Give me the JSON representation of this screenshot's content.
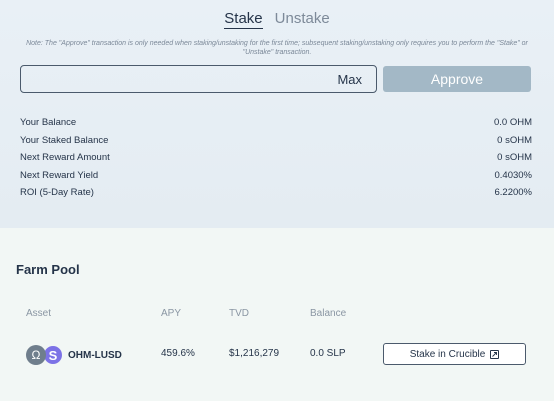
{
  "tabs": [
    {
      "label": "Stake",
      "active": true
    },
    {
      "label": "Unstake",
      "active": false
    }
  ],
  "note": "Note: The \"Approve\" transaction is only needed when staking/unstaking for the first time; subsequent staking/unstaking only requires you to perform the \"Stake\" or \"Unstake\" transaction.",
  "amount_input": {
    "value": "",
    "max_label": "Max"
  },
  "approve_label": "Approve",
  "stats": [
    {
      "label": "Your Balance",
      "value": "0.0 OHM"
    },
    {
      "label": "Your Staked Balance",
      "value": "0 sOHM"
    },
    {
      "label": "Next Reward Amount",
      "value": "0 sOHM"
    },
    {
      "label": "Next Reward Yield",
      "value": "0.4030%"
    },
    {
      "label": "ROI (5-Day Rate)",
      "value": "6.2200%"
    }
  ],
  "farm": {
    "title": "Farm Pool",
    "headers": {
      "asset": "Asset",
      "apy": "APY",
      "tvd": "TVD",
      "balance": "Balance"
    },
    "row": {
      "asset": "OHM-LUSD",
      "ohm_icon_glyph": "Ω",
      "lusd_icon_glyph": "S",
      "apy": "459.6%",
      "tvd": "$1,216,279",
      "balance": "0.0 SLP",
      "action": "Stake in Crucible"
    }
  },
  "colors": {
    "accent": "#a3b8c6",
    "text": "#253449",
    "muted": "#8a96a3",
    "lusd": "#7c72e6"
  }
}
